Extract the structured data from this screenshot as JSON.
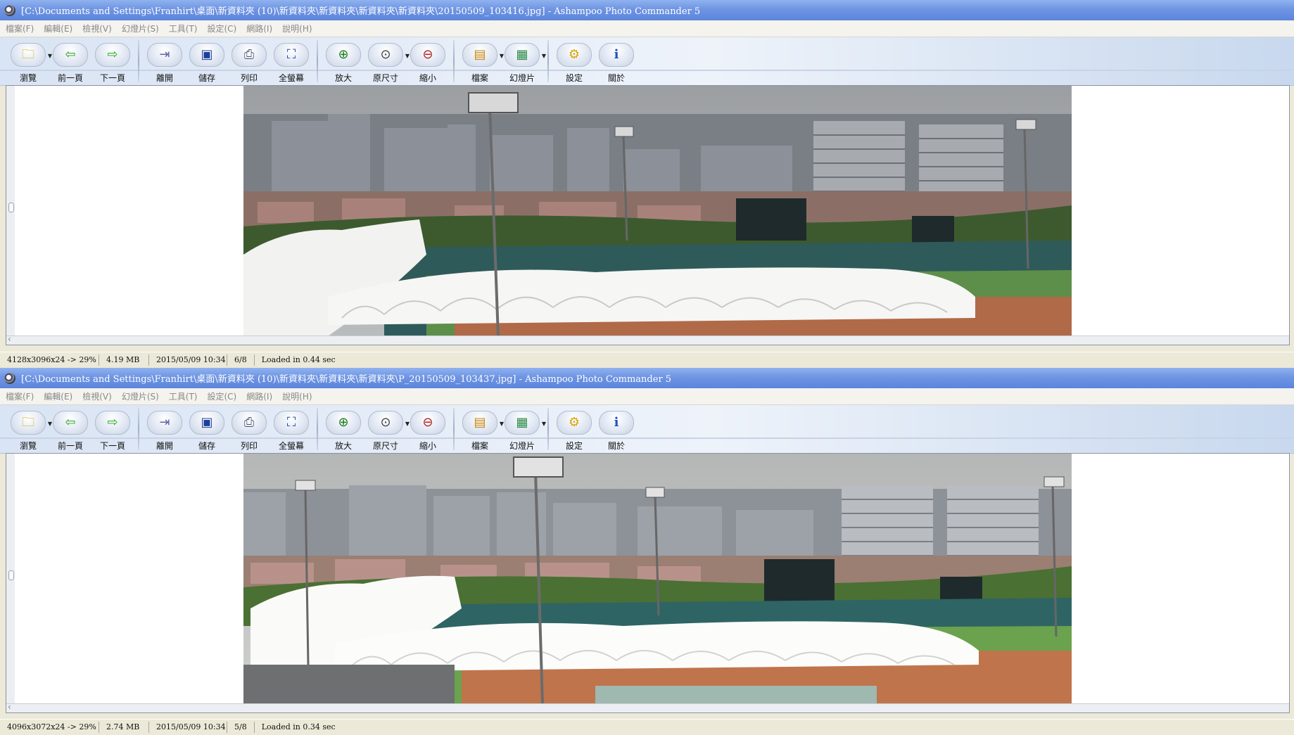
{
  "windows": [
    {
      "title": "[C:\\Documents and Settings\\Franhirt\\桌面\\新資料夾 (10)\\新資料夾\\新資料夾\\新資料夾\\新資料夾\\20150509_103416.jpg] - Ashampoo Photo Commander 5",
      "status": {
        "dimensions": "4128x3096x24 -> 29%",
        "size": "4.19 MB",
        "date": "2015/05/09 10:34",
        "index": "6/8",
        "load": "Loaded in 0.44 sec"
      }
    },
    {
      "title": "[C:\\Documents and Settings\\Franhirt\\桌面\\新資料夾 (10)\\新資料夾\\新資料夾\\新資料夾\\P_20150509_103437.jpg] - Ashampoo Photo Commander 5",
      "status": {
        "dimensions": "4096x3072x24 -> 29%",
        "size": "2.74 MB",
        "date": "2015/05/09 10:34",
        "index": "5/8",
        "load": "Loaded in 0.34 sec"
      }
    }
  ],
  "menu": [
    "檔案(F)",
    "編輯(E)",
    "檢視(V)",
    "幻燈片(S)",
    "工具(T)",
    "設定(C)",
    "網路(I)",
    "說明(H)"
  ],
  "toolbar": {
    "browse": "瀏覽",
    "prev": "前一頁",
    "next": "下一頁",
    "close": "離開",
    "save": "儲存",
    "print": "列印",
    "fullscreen": "全螢幕",
    "zoom_in": "放大",
    "actual_size": "原尺寸",
    "zoom_out": "縮小",
    "file": "檔案",
    "slideshow": "幻燈片",
    "settings": "設定",
    "about": "關於"
  },
  "icons": {
    "browse": "folder-search-icon",
    "prev": "arrow-left-icon",
    "next": "arrow-right-icon",
    "close": "exit-door-icon",
    "save": "floppy-disk-icon",
    "print": "printer-icon",
    "fullscreen": "fullscreen-icon",
    "zoom_in": "zoom-in-icon",
    "actual_size": "actual-size-icon",
    "zoom_out": "zoom-out-icon",
    "file": "file-icon",
    "slideshow": "slideshow-icon",
    "settings": "settings-icon",
    "about": "info-icon"
  },
  "colors": {
    "titlebar": "#6f95e3",
    "toolbar": "#dfe8f5",
    "status_bar": "#ece9d8"
  }
}
